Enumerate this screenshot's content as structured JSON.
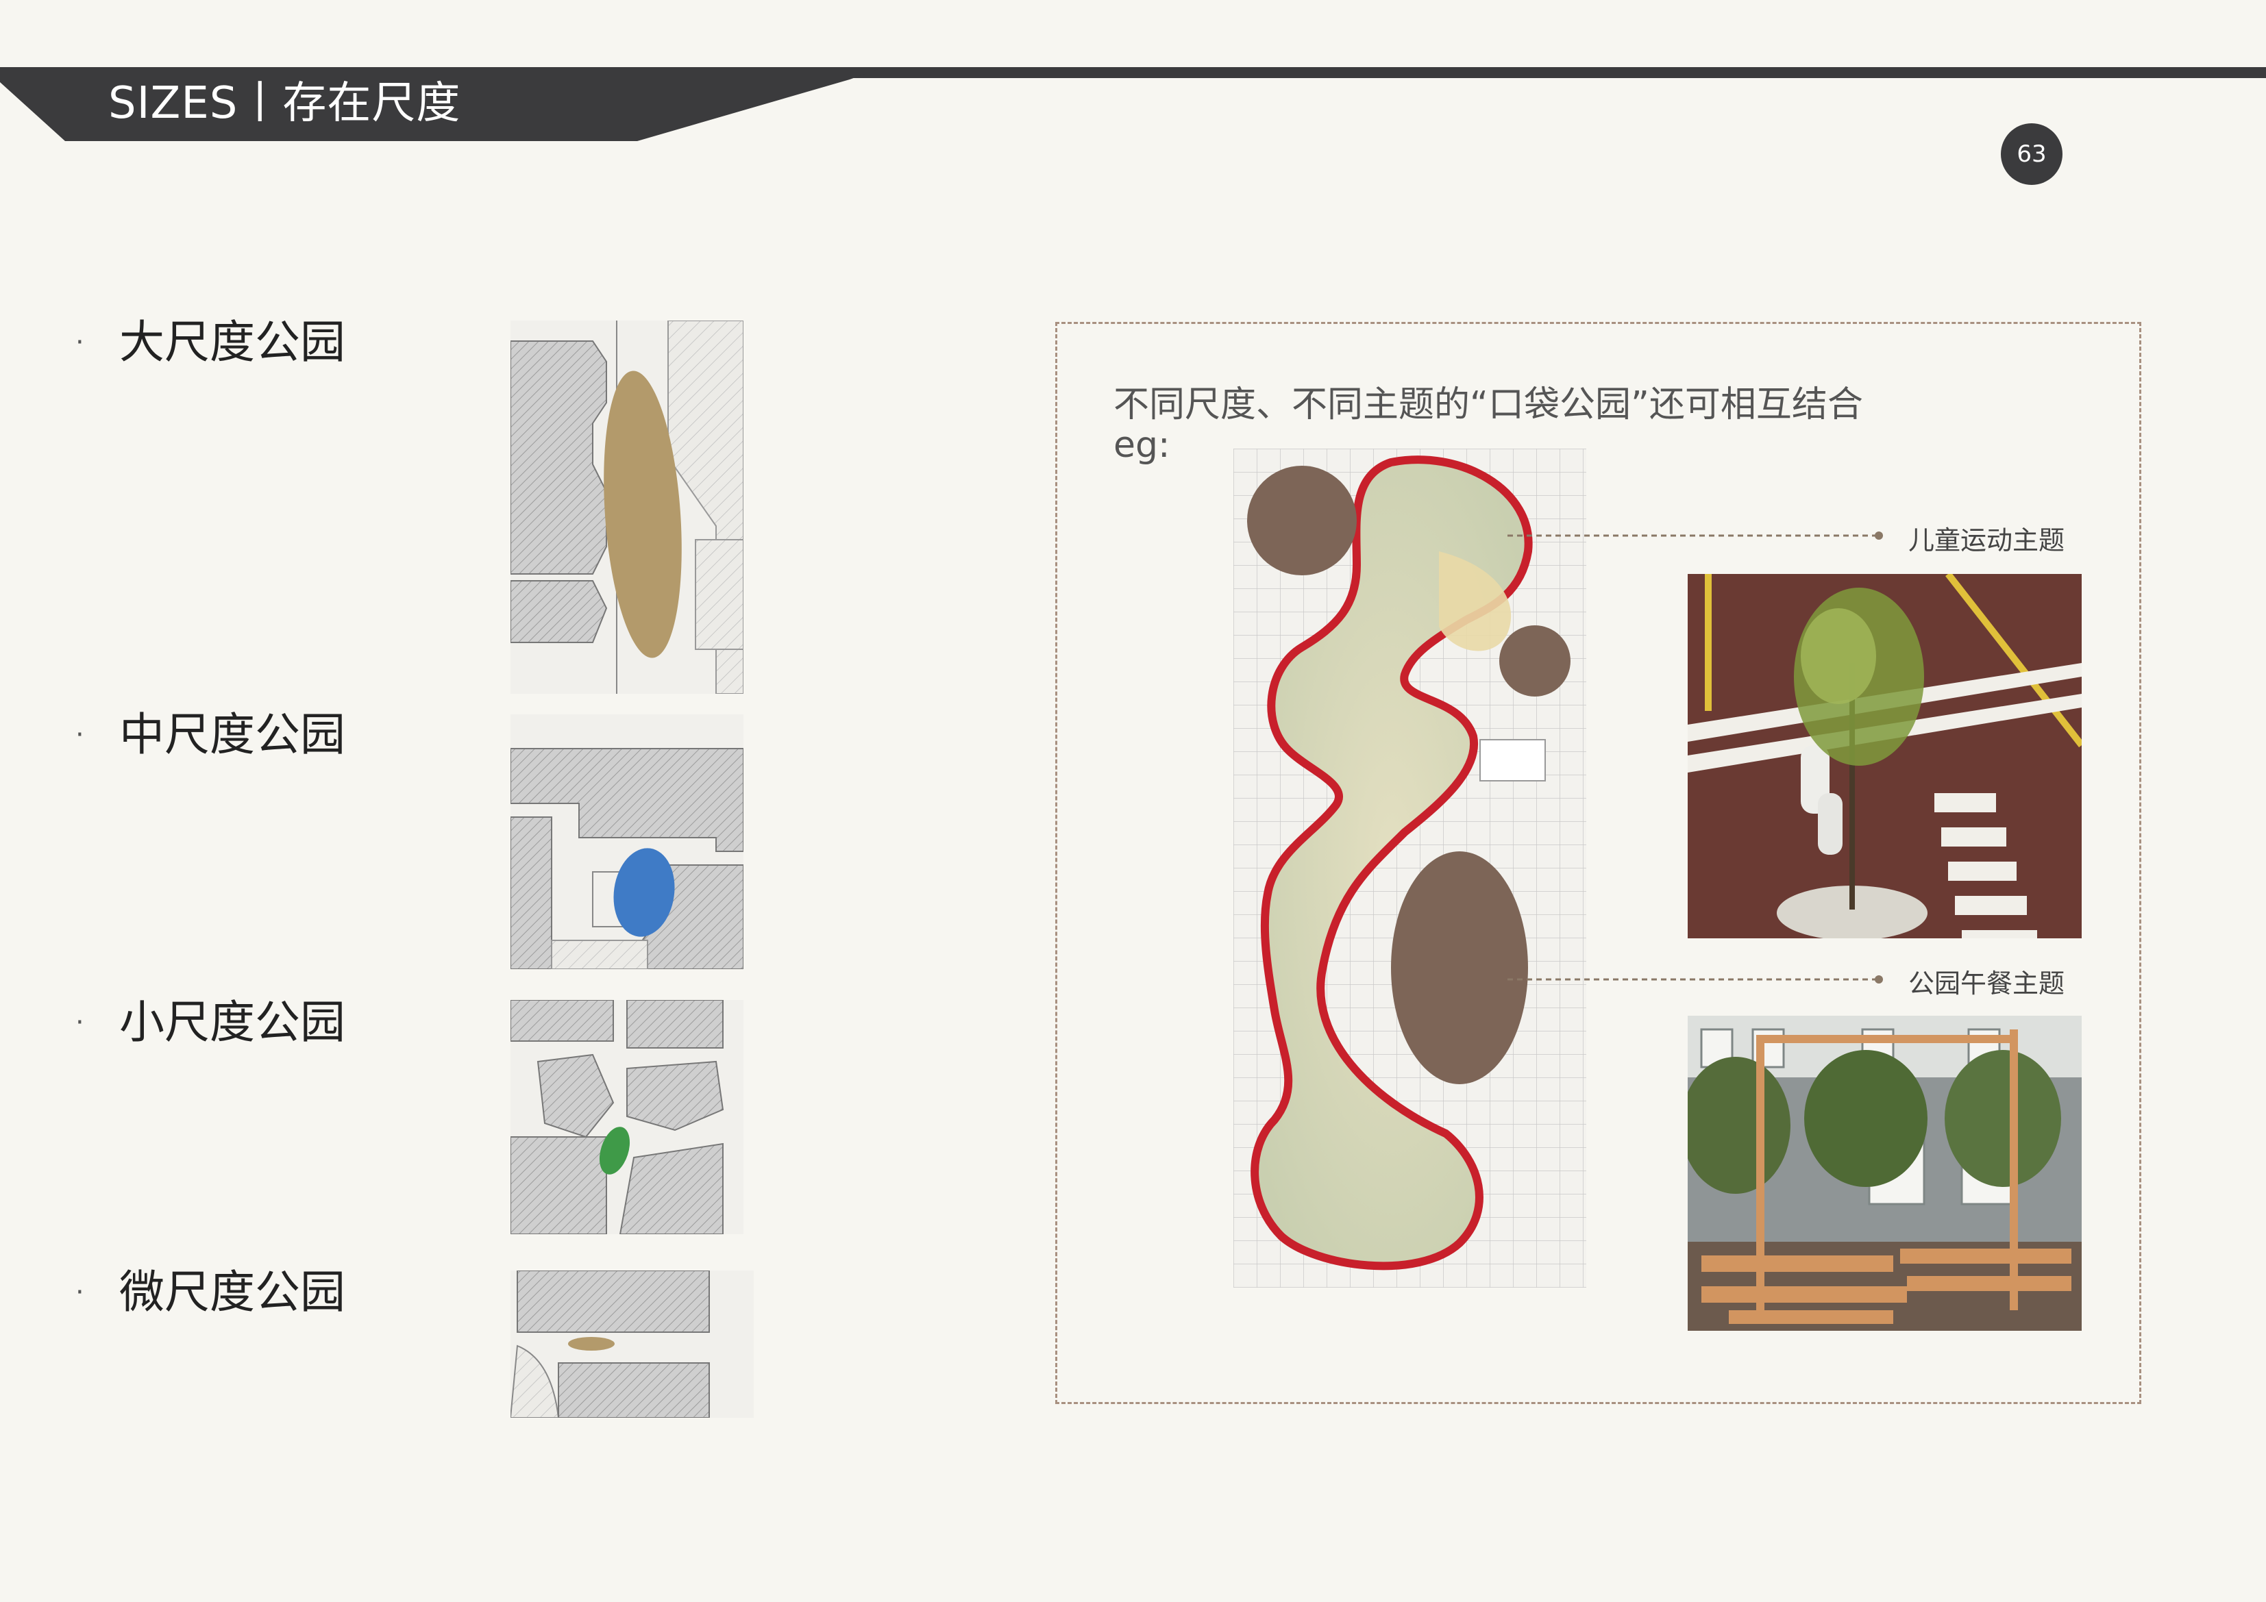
{
  "header": {
    "title": "SIZES丨存在尺度",
    "page_number": "63"
  },
  "scale_list": [
    {
      "bullet": "·",
      "label": "大尺度公园",
      "highlight_color": "#b39a6b"
    },
    {
      "bullet": "·",
      "label": "中尺度公园",
      "highlight_color": "#3f7bc6"
    },
    {
      "bullet": "·",
      "label": "小尺度公园",
      "highlight_color": "#3f9a48"
    },
    {
      "bullet": "·",
      "label": "微尺度公园",
      "highlight_color": "#b39a6b"
    }
  ],
  "example": {
    "title": "不同尺度、不同主题的“口袋公园”还可相互结合",
    "eg_label": "eg:",
    "themes": [
      {
        "label": "儿童运动主题",
        "photo": "children-sports-plaza-photo"
      },
      {
        "label": "公园午餐主题",
        "photo": "park-lunch-seating-photo"
      }
    ]
  },
  "colors": {
    "header_bar": "#3b3b3d",
    "background": "#f7f6f1",
    "plaza_path_red": "#c8202b",
    "circle_brown": "#7d6557",
    "dashed_border": "#a89080"
  }
}
